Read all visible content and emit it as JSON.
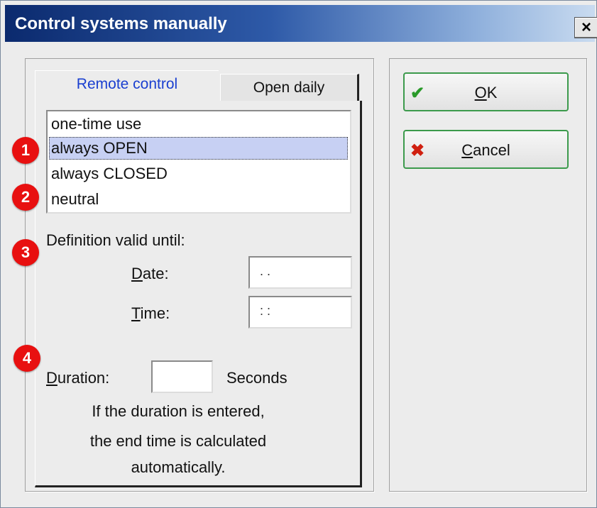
{
  "window": {
    "title": "Control systems manually",
    "close_label": "×"
  },
  "tabs": [
    {
      "label": "Remote control",
      "active": true
    },
    {
      "label": "Open daily",
      "active": false
    }
  ],
  "mode_list": {
    "items": [
      {
        "label": "one-time use",
        "selected": false
      },
      {
        "label": "always OPEN",
        "selected": true
      },
      {
        "label": "always CLOSED",
        "selected": false
      },
      {
        "label": "neutral",
        "selected": false
      }
    ]
  },
  "badges": [
    "1",
    "2",
    "3",
    "4"
  ],
  "validity": {
    "heading": "Definition valid until:",
    "date_label_first": "D",
    "date_label_rest": "ate:",
    "date_value": ". .",
    "time_label_first": "T",
    "time_label_rest": "ime:",
    "time_value": ": :"
  },
  "duration": {
    "label_first": "D",
    "label_rest": "uration:",
    "value": "",
    "unit": "Seconds",
    "note_line1": "If the duration is entered,",
    "note_line2": "the end time is calculated",
    "note_line3": "automatically."
  },
  "buttons": {
    "ok_first": "O",
    "ok_rest": "K",
    "cancel_first": "C",
    "cancel_rest": "ancel"
  },
  "colors": {
    "title_gradient_start": "#0b2a6e",
    "tab_active_text": "#1a3fd0",
    "selection_bg": "#c7d0f3",
    "badge_red": "#e81010",
    "ok_check": "#2a9a2a",
    "cancel_x": "#d02010"
  },
  "icons": {
    "ok": "checkmark-icon",
    "cancel": "x-icon"
  }
}
